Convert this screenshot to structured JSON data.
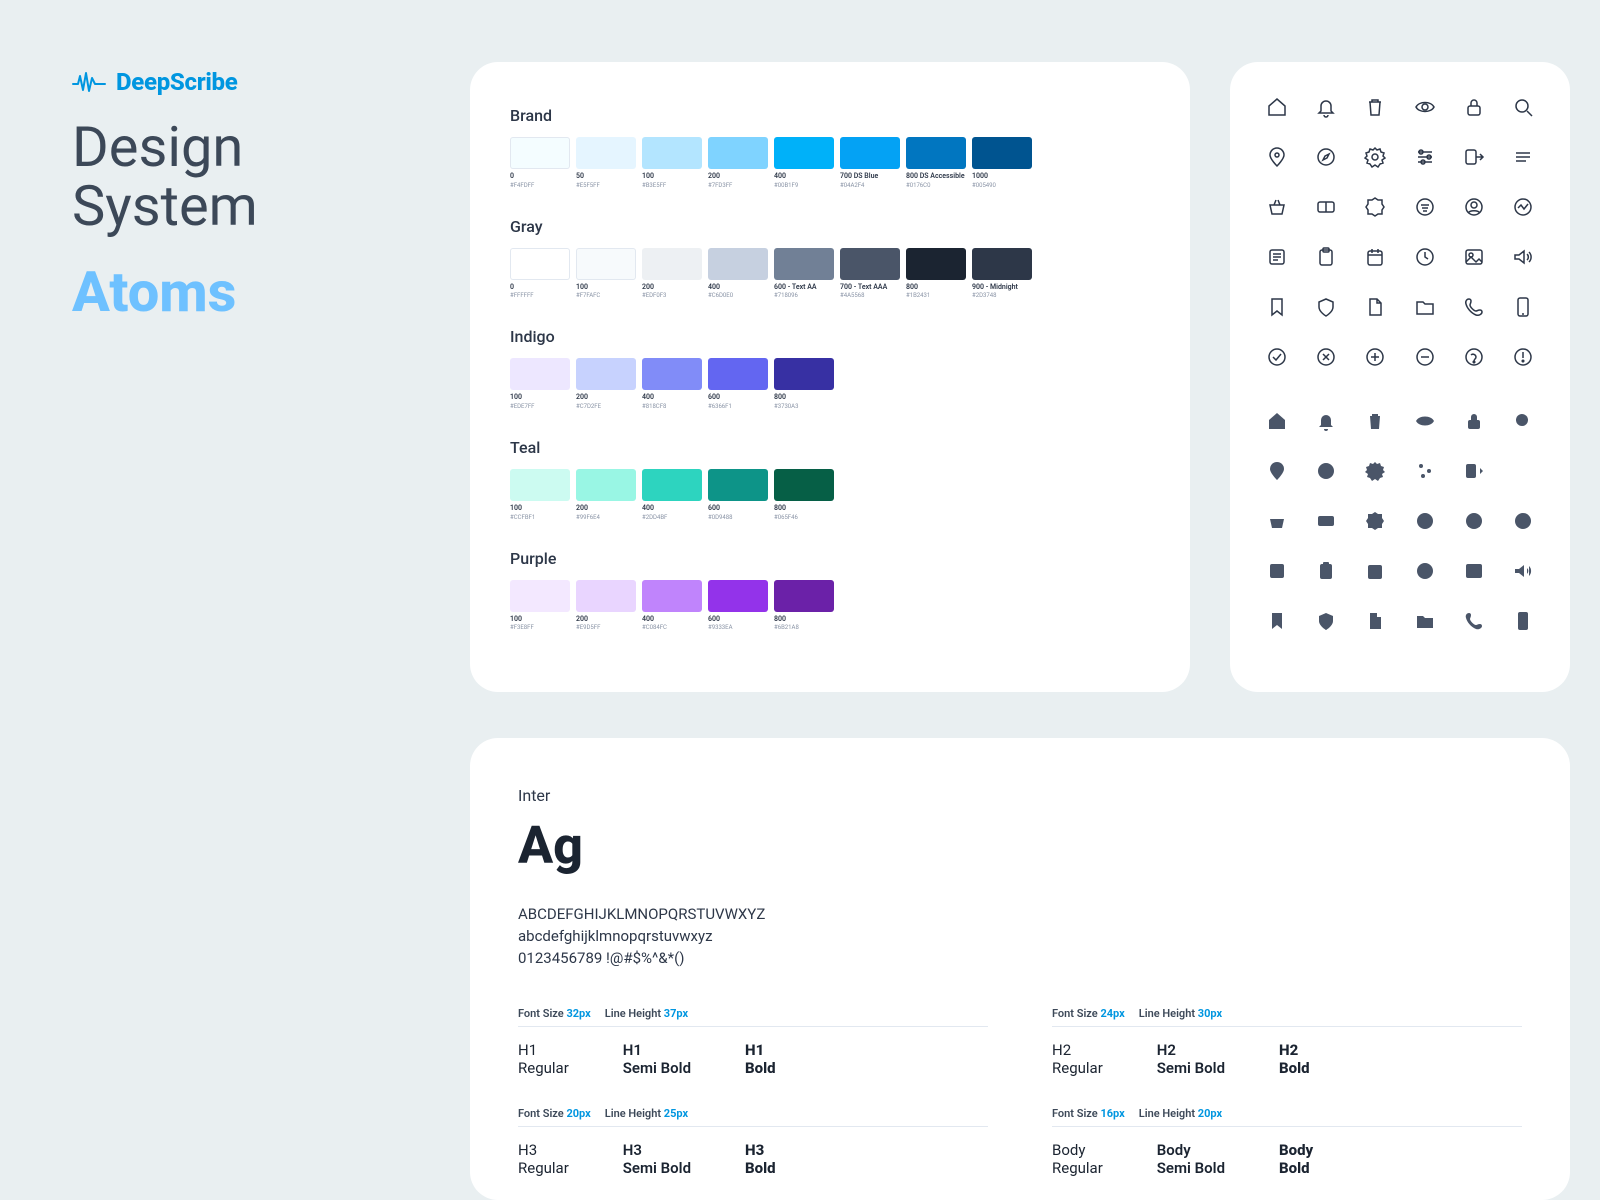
{
  "logo": {
    "text": "DeepScribe"
  },
  "title": {
    "line1": "Design",
    "line2": "System",
    "sub": "Atoms"
  },
  "colors": [
    {
      "name": "Brand",
      "swatches": [
        {
          "label": "0",
          "hex": "#F4FDFF"
        },
        {
          "label": "50",
          "hex": "#E5F5FF"
        },
        {
          "label": "100",
          "hex": "#B3E5FF"
        },
        {
          "label": "200",
          "hex": "#7FD3FF"
        },
        {
          "label": "400",
          "hex": "#00B1F9"
        },
        {
          "label": "700 DS Blue",
          "hex": "#04A2F4"
        },
        {
          "label": "800 DS Accessible",
          "hex": "#0176C0"
        },
        {
          "label": "1000",
          "hex": "#005490"
        }
      ]
    },
    {
      "name": "Gray",
      "swatches": [
        {
          "label": "0",
          "hex": "#FFFFFF"
        },
        {
          "label": "100",
          "hex": "#F7FAFC"
        },
        {
          "label": "200",
          "hex": "#EDF0F3"
        },
        {
          "label": "400",
          "hex": "#C6D0E0"
        },
        {
          "label": "600 - Text AA",
          "hex": "#718096"
        },
        {
          "label": "700 - Text AAA",
          "hex": "#4A5568"
        },
        {
          "label": "800",
          "hex": "#1B2431"
        },
        {
          "label": "900 - Midnight",
          "hex": "#2D3748"
        }
      ]
    },
    {
      "name": "Indigo",
      "swatches": [
        {
          "label": "100",
          "hex": "#EDE7FF"
        },
        {
          "label": "200",
          "hex": "#C7D2FE"
        },
        {
          "label": "400",
          "hex": "#818CF8"
        },
        {
          "label": "600",
          "hex": "#6366F1"
        },
        {
          "label": "800",
          "hex": "#3730A3"
        }
      ]
    },
    {
      "name": "Teal",
      "swatches": [
        {
          "label": "100",
          "hex": "#CCFBF1"
        },
        {
          "label": "200",
          "hex": "#99F6E4"
        },
        {
          "label": "400",
          "hex": "#2DD4BF"
        },
        {
          "label": "600",
          "hex": "#0D9488"
        },
        {
          "label": "800",
          "hex": "#065F46"
        }
      ]
    },
    {
      "name": "Purple",
      "swatches": [
        {
          "label": "100",
          "hex": "#F3E8FF"
        },
        {
          "label": "200",
          "hex": "#E9D5FF"
        },
        {
          "label": "400",
          "hex": "#C084FC"
        },
        {
          "label": "600",
          "hex": "#9333EA"
        },
        {
          "label": "800",
          "hex": "#6B21A8"
        }
      ]
    }
  ],
  "iconsOutline": [
    "home",
    "bell",
    "trash",
    "eye",
    "lock",
    "search",
    "pin",
    "compass",
    "settings",
    "sliders",
    "logout",
    "menu",
    "basket",
    "ticket",
    "badge",
    "filter",
    "user-circle",
    "activity",
    "note",
    "clipboard",
    "calendar",
    "clock",
    "image",
    "volume",
    "bookmark",
    "shield",
    "file",
    "folder",
    "phone",
    "smartphone",
    "check-circle",
    "x-circle",
    "plus-circle",
    "minus-circle",
    "help-circle",
    "alert-circle"
  ],
  "iconsSolid": [
    "home",
    "bell",
    "trash",
    "eye",
    "lock",
    "search",
    "pin",
    "compass",
    "settings",
    "sliders",
    "logout",
    "menu",
    "basket",
    "ticket",
    "badge",
    "filter",
    "user-circle",
    "activity",
    "note",
    "clipboard",
    "calendar",
    "clock",
    "image",
    "volume",
    "bookmark",
    "shield",
    "file",
    "folder",
    "phone",
    "smartphone"
  ],
  "typography": {
    "family": "Inter",
    "sample": "Ag",
    "alpha_upper": "ABCDEFGHIJKLMNOPQRSTUVWXYZ",
    "alpha_lower": "abcdefghijklmnopqrstuvwxyz",
    "alpha_nums": "0123456789 !@#$%^&*()",
    "spec_fs": "Font Size",
    "spec_lh": "Line Height",
    "columns": [
      {
        "rows": [
          {
            "name": "H1",
            "fs": "32px",
            "lh": "37px",
            "weights": [
              "Regular",
              "Semi Bold",
              "Bold"
            ]
          },
          {
            "name": "H3",
            "fs": "20px",
            "lh": "25px",
            "weights": [
              "Regular",
              "Semi Bold",
              "Bold"
            ]
          }
        ]
      },
      {
        "rows": [
          {
            "name": "H2",
            "fs": "24px",
            "lh": "30px",
            "weights": [
              "Regular",
              "Semi Bold",
              "Bold"
            ]
          },
          {
            "name": "Body",
            "fs": "16px",
            "lh": "20px",
            "weights": [
              "Regular",
              "Semi Bold",
              "Bold"
            ]
          }
        ]
      }
    ]
  }
}
